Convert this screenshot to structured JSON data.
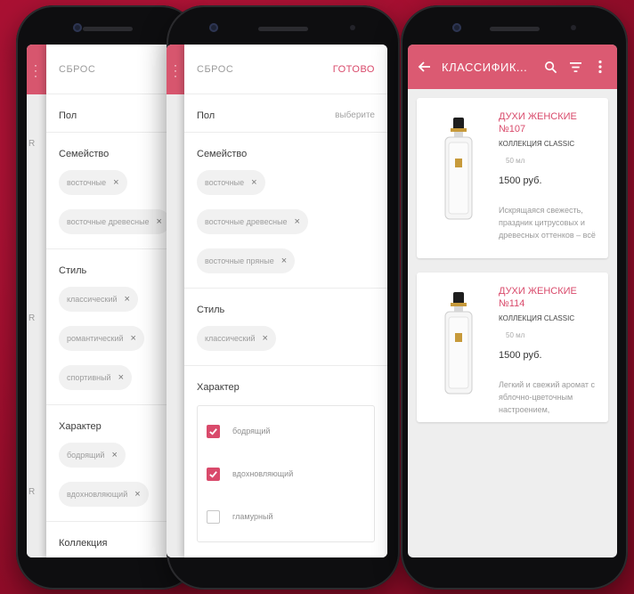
{
  "panel1": {
    "reset": "СБРОС",
    "gender_title": "Пол",
    "family_title": "Семейство",
    "family_chips": [
      "восточные",
      "восточные древесные"
    ],
    "style_title": "Стиль",
    "style_chips": [
      "классический",
      "романтический",
      "спортивный"
    ],
    "character_title": "Характер",
    "character_chips": [
      "бодрящий",
      "вдохновляющий"
    ],
    "collection_title": "Коллекция",
    "behind_letters": [
      "R",
      "R",
      "R"
    ]
  },
  "panel2": {
    "reset": "СБРОС",
    "done": "ГОТОВО",
    "gender_title": "Пол",
    "gender_value": "выберите",
    "family_title": "Семейство",
    "family_chips": [
      "восточные",
      "восточные древесные",
      "восточные пряные"
    ],
    "style_title": "Стиль",
    "style_chips": [
      "классический"
    ],
    "character_title": "Характер",
    "character_options": [
      {
        "label": "бодрящий",
        "checked": true
      },
      {
        "label": "вдохновляющий",
        "checked": true
      },
      {
        "label": "гламурный",
        "checked": false
      }
    ]
  },
  "catalog": {
    "title": "КЛАССИФИК...",
    "accent": "#db5a72",
    "products": [
      {
        "name": "ДУХИ ЖЕНСКИЕ №107",
        "collection": "КОЛЛЕКЦИЯ CLASSIC",
        "volume": "50 мл",
        "price": "1500 руб.",
        "description": "Искрящаяся свежесть, праздник цитрусовых и древесных оттенков – всё"
      },
      {
        "name": "ДУХИ ЖЕНСКИЕ №114",
        "collection": "КОЛЛЕКЦИЯ CLASSIC",
        "volume": "50 мл",
        "price": "1500 руб.",
        "description": "Легкий и свежий аромат с яблочно-цветочным настроением,"
      }
    ]
  },
  "icons": [
    "back-arrow-icon",
    "search-icon",
    "filter-icon",
    "more-vert-icon",
    "close-icon",
    "checkmark-icon",
    "perfume-bottle-icon"
  ]
}
